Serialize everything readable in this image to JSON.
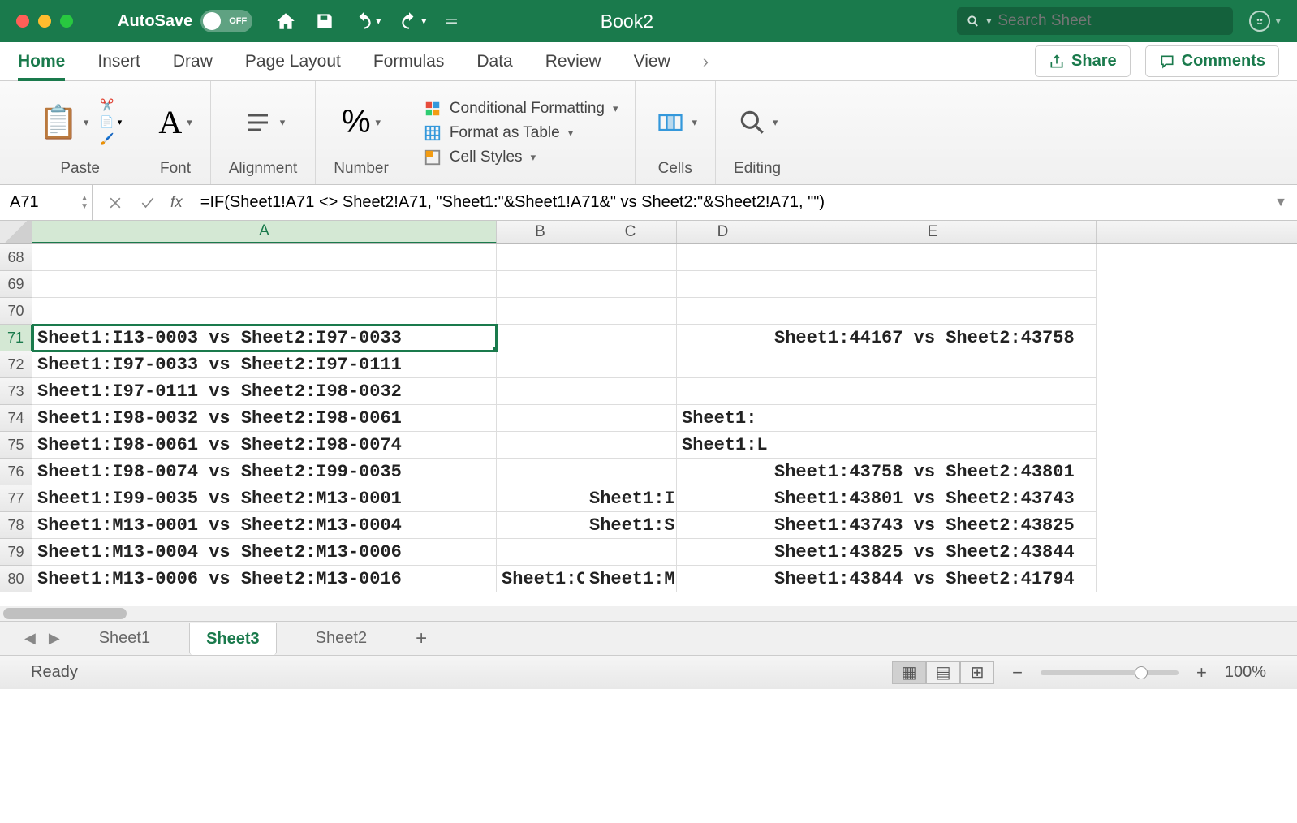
{
  "title_bar": {
    "autosave_label": "AutoSave",
    "autosave_state": "OFF",
    "title": "Book2",
    "search_placeholder": "Search Sheet"
  },
  "ribbon_tabs": [
    "Home",
    "Insert",
    "Draw",
    "Page Layout",
    "Formulas",
    "Data",
    "Review",
    "View"
  ],
  "ribbon_active_tab": "Home",
  "ribbon_actions": {
    "share": "Share",
    "comments": "Comments"
  },
  "ribbon_groups": {
    "paste": "Paste",
    "font": "Font",
    "alignment": "Alignment",
    "number": "Number",
    "cond_format": "Conditional Formatting",
    "format_table": "Format as Table",
    "cell_styles": "Cell Styles",
    "cells": "Cells",
    "editing": "Editing"
  },
  "formula_bar": {
    "name_box": "A71",
    "formula": "=IF(Sheet1!A71 <> Sheet2!A71, \"Sheet1:\"&Sheet1!A71&\" vs Sheet2:\"&Sheet2!A71, \"\")"
  },
  "columns": [
    "A",
    "B",
    "C",
    "D",
    "E"
  ],
  "rows": [
    {
      "n": 68,
      "a": "",
      "b": "",
      "c": "",
      "d": "",
      "e": ""
    },
    {
      "n": 69,
      "a": "",
      "b": "",
      "c": "",
      "d": "",
      "e": ""
    },
    {
      "n": 70,
      "a": "",
      "b": "",
      "c": "",
      "d": "",
      "e": ""
    },
    {
      "n": 71,
      "a": "Sheet1:I13-0003 vs Sheet2:I97-0033",
      "b": "",
      "c": "",
      "d": "",
      "e": "Sheet1:44167 vs Sheet2:43758"
    },
    {
      "n": 72,
      "a": "Sheet1:I97-0033 vs Sheet2:I97-0111",
      "b": "",
      "c": "",
      "d": "",
      "e": ""
    },
    {
      "n": 73,
      "a": "Sheet1:I97-0111 vs Sheet2:I98-0032",
      "b": "",
      "c": "",
      "d": "",
      "e": ""
    },
    {
      "n": 74,
      "a": "Sheet1:I98-0032 vs Sheet2:I98-0061",
      "b": "",
      "c": "",
      "d": "Sheet1:",
      "e": ""
    },
    {
      "n": 75,
      "a": "Sheet1:I98-0061 vs Sheet2:I98-0074",
      "b": "",
      "c": "",
      "d": "Sheet1:L",
      "e": ""
    },
    {
      "n": 76,
      "a": "Sheet1:I98-0074 vs Sheet2:I99-0035",
      "b": "",
      "c": "",
      "d": "",
      "e": "Sheet1:43758 vs Sheet2:43801"
    },
    {
      "n": 77,
      "a": "Sheet1:I99-0035 vs Sheet2:M13-0001",
      "b": "",
      "c": "Sheet1:I",
      "d": "",
      "e": "Sheet1:43801 vs Sheet2:43743"
    },
    {
      "n": 78,
      "a": "Sheet1:M13-0001 vs Sheet2:M13-0004",
      "b": "",
      "c": "Sheet1:S",
      "d": "",
      "e": "Sheet1:43743 vs Sheet2:43825"
    },
    {
      "n": 79,
      "a": "Sheet1:M13-0004 vs Sheet2:M13-0006",
      "b": "",
      "c": "",
      "d": "",
      "e": "Sheet1:43825 vs Sheet2:43844"
    },
    {
      "n": 80,
      "a": "Sheet1:M13-0006 vs Sheet2:M13-0016",
      "b": "Sheet1:C",
      "c": "Sheet1:M",
      "d": "",
      "e": "Sheet1:43844 vs Sheet2:41794"
    }
  ],
  "selected_row": 71,
  "sheets": [
    "Sheet1",
    "Sheet3",
    "Sheet2"
  ],
  "active_sheet": "Sheet3",
  "status": {
    "ready": "Ready",
    "zoom": "100%"
  }
}
